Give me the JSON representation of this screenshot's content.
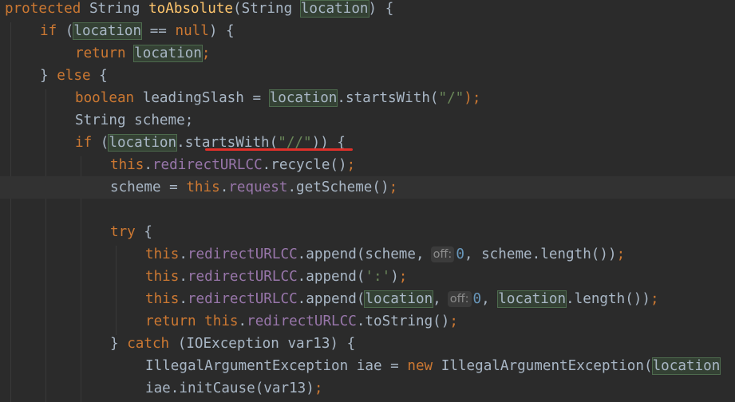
{
  "code": {
    "line1": {
      "kw_protected": "protected",
      "type_string": "String",
      "method_name": "toAbsolute",
      "param_open": "(String ",
      "param_location": "location",
      "param_close": ") {"
    },
    "line2": {
      "kw_if": "if",
      "open": "(",
      "var_location": "location",
      "cond": " == ",
      "kw_null": "null",
      "close": ") {"
    },
    "line3": {
      "kw_return": "return",
      "var_location": "location",
      "semi": ";"
    },
    "line4": {
      "brace": "} ",
      "kw_else": "else",
      "open_brace": " {"
    },
    "line5": {
      "kw_boolean": "boolean",
      "decl": " leadingSlash = ",
      "var_location": "location",
      "call": ".startsWith(",
      "str_slash": "\"/\"",
      "end": ");"
    },
    "line6": {
      "text": "String scheme;"
    },
    "line7": {
      "kw_if": "if",
      "open": " (",
      "var_location": "location",
      "call": ".startsWith(",
      "str_double_slash": "\"//\"",
      "end": ")) {"
    },
    "line8": {
      "kw_this": "this",
      "dot": ".",
      "field": "redirectURLCC",
      "call": ".recycle()",
      "semi": ";"
    },
    "line9": {
      "lhs": "scheme = ",
      "kw_this": "this",
      "dot": ".",
      "field": "request",
      "call": ".getScheme()",
      "semi": ";"
    },
    "line11": {
      "kw_try": "try",
      "brace": " {"
    },
    "line12": {
      "kw_this": "this",
      "dot": ".",
      "field": "redirectURLCC",
      "call": ".append(scheme,",
      "hint_off": "off:",
      "num_zero": "0",
      "rest": ", scheme.length())",
      "semi": ";"
    },
    "line13": {
      "kw_this": "this",
      "dot": ".",
      "field": "redirectURLCC",
      "call": ".append(",
      "str_colon": "':'",
      "end": ")",
      "semi": ";"
    },
    "line14": {
      "kw_this": "this",
      "dot": ".",
      "field": "redirectURLCC",
      "call": ".append(",
      "var_location": "location",
      "comma": ",",
      "hint_off": "off:",
      "num_zero": "0",
      "comma2": ", ",
      "var_location2": "location",
      "rest": ".length())",
      "semi": ";"
    },
    "line15": {
      "kw_return": "return",
      "sp": " ",
      "kw_this": "this",
      "dot": ".",
      "field": "redirectURLCC",
      "call": ".toString()",
      "semi": ";"
    },
    "line16": {
      "brace": "} ",
      "kw_catch": "catch",
      "rest": " (IOException var13) {"
    },
    "line17": {
      "decl": "IllegalArgumentException iae = ",
      "kw_new": "new",
      "ctor": " IllegalArgumentException(",
      "var_location": "location"
    },
    "line18": {
      "text": "iae.initCause(var13)",
      "semi": ";"
    }
  },
  "colors": {
    "background": "#2b2b2b",
    "keyword": "#cc7832",
    "method": "#ffc66d",
    "field": "#9876aa",
    "string": "#6a8759",
    "number": "#6897bb",
    "plain": "#a9b7c6",
    "highlight": "#344134",
    "error_underline": "#e0302a"
  }
}
